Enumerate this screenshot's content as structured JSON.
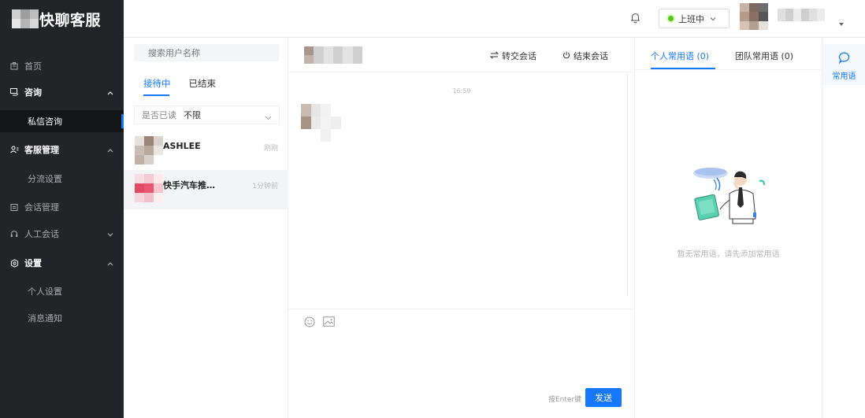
{
  "app": {
    "title": "快聊客服"
  },
  "sidebar": {
    "home": "首页",
    "consult": "咨询",
    "private_consult": "私信咨询",
    "service_mgmt": "客服管理",
    "diversion": "分流设置",
    "session_mgmt": "会话管理",
    "manual_session": "人工会话",
    "settings": "设置",
    "personal_settings": "个人设置",
    "notifications": "消息通知"
  },
  "topbar": {
    "status": "上班中"
  },
  "conversations": {
    "search_placeholder": "搜索用户名称",
    "tabs": [
      "接待中",
      "已结束"
    ],
    "filter_label": "是否已读",
    "filter_value": "不限",
    "items": [
      {
        "name": "ASHLEE",
        "time": "刚刚"
      },
      {
        "name": "快手汽车推…",
        "time": "1分钟前"
      }
    ]
  },
  "chat": {
    "transfer": "转交会话",
    "end": "结束会话",
    "message_time": "16:59",
    "send_hint": "按Enter键",
    "send": "发送"
  },
  "phrases": {
    "tab_personal": "个人常用语",
    "tab_personal_count": "(0)",
    "tab_team": "团队常用语",
    "tab_team_count": "(0)",
    "empty": "暂无常用语，请先添加常用语"
  },
  "rail": {
    "label": "常用语"
  },
  "colors": {
    "accent": "#1677ff",
    "sidebar_bg": "#222427",
    "online": "#52c41a"
  }
}
